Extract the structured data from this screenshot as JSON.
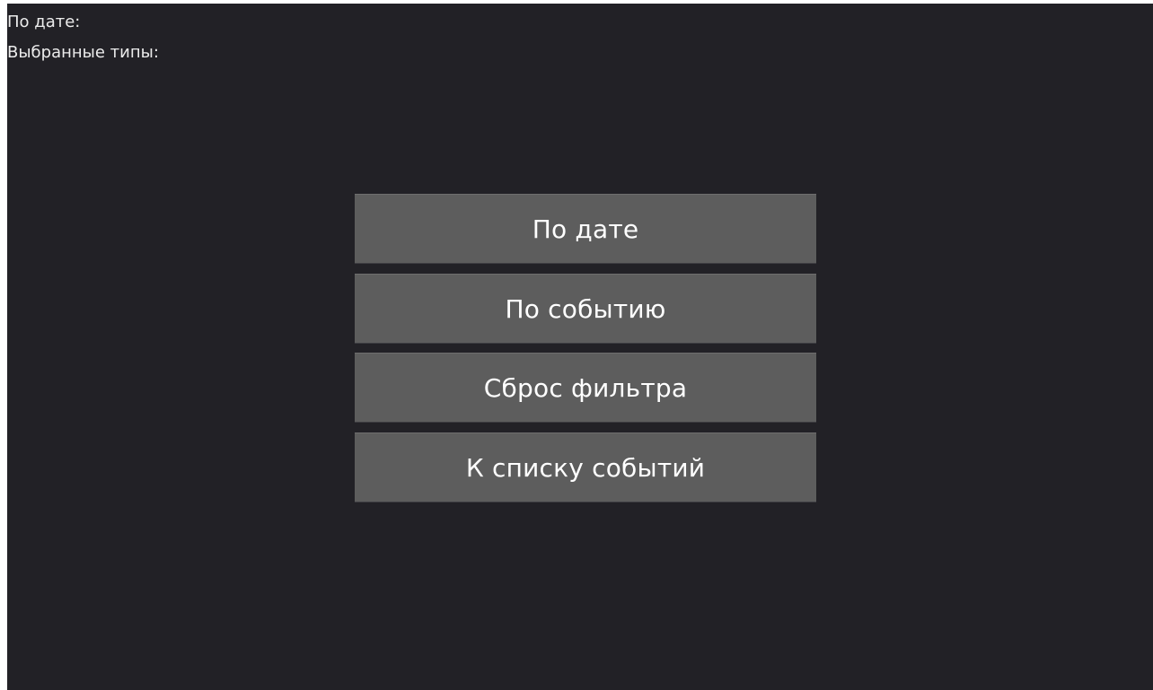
{
  "status": {
    "date_label": "По дате:",
    "types_label": "Выбранные типы:"
  },
  "menu": {
    "by_date": "По дате",
    "by_event": "По событию",
    "reset_filter": "Сброс фильтра",
    "to_event_list": "К списку событий"
  },
  "colors": {
    "background": "#222126",
    "button": "#5d5d5d",
    "text": "#ffffff"
  }
}
